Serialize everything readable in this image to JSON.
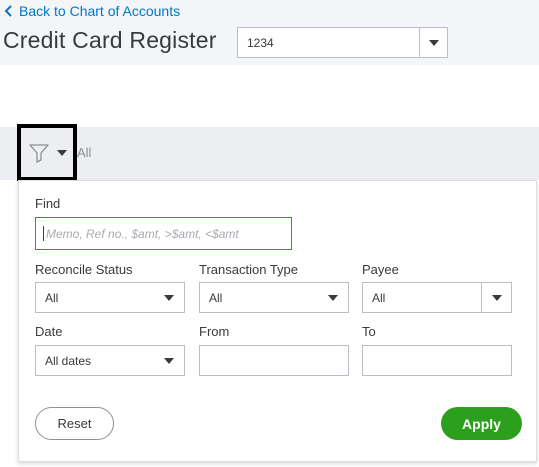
{
  "header": {
    "back_link": "Back to Chart of Accounts",
    "title": "Credit Card Register",
    "account_select_value": "1234"
  },
  "toolbar": {
    "filter_summary": "All"
  },
  "filter_panel": {
    "find_label": "Find",
    "find_placeholder": "Memo, Ref no., $amt, >$amt, <$amt",
    "reconcile_label": "Reconcile Status",
    "reconcile_value": "All",
    "type_label": "Transaction Type",
    "type_value": "All",
    "payee_label": "Payee",
    "payee_value": "All",
    "date_label": "Date",
    "date_value": "All dates",
    "from_label": "From",
    "from_value": "",
    "to_label": "To",
    "to_value": "",
    "reset_label": "Reset",
    "apply_label": "Apply"
  },
  "colors": {
    "link_blue": "#0077c5",
    "primary_green": "#2ca01c",
    "focus_border": "#2ca01c",
    "header_bg": "#f4f5f8",
    "toolbar_bg": "#eceef1"
  },
  "icons": {
    "back": "chevron-left-icon",
    "account_dropdown": "caret-down-icon",
    "filter": "funnel-icon",
    "filter_dropdown": "caret-down-icon"
  }
}
